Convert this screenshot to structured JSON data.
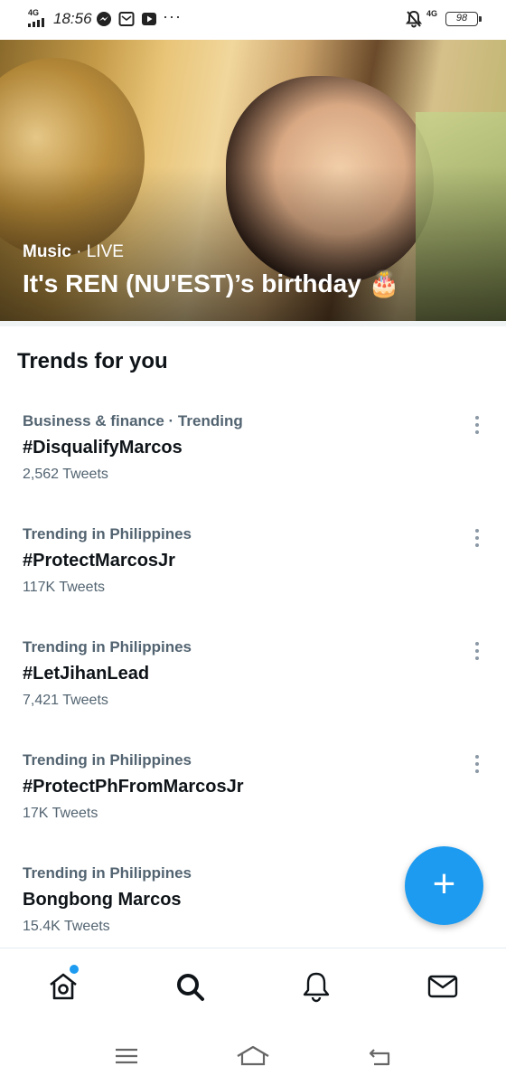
{
  "status_bar": {
    "network": "4G",
    "time": "18:56",
    "more": "···",
    "network_right": "4G",
    "battery": "98",
    "icons": [
      "signal-icon",
      "messenger-icon",
      "mail-app-icon",
      "youtube-icon",
      "bell-off-icon"
    ]
  },
  "hero": {
    "category": "Music",
    "separator": " · ",
    "status": "LIVE",
    "title": "It's REN (NU'EST)’s birthday",
    "emoji": "🎂"
  },
  "trends": {
    "heading": "Trends for you",
    "items": [
      {
        "context": "Business & finance · Trending",
        "name": "#DisqualifyMarcos",
        "count": "2,562 Tweets"
      },
      {
        "context": "Trending in Philippines",
        "name": "#ProtectMarcosJr",
        "count": "117K Tweets"
      },
      {
        "context": "Trending in Philippines",
        "name": "#LetJihanLead",
        "count": "7,421 Tweets"
      },
      {
        "context": "Trending in Philippines",
        "name": "#ProtectPhFromMarcosJr",
        "count": "17K Tweets"
      },
      {
        "context": "Trending in Philippines",
        "name": "Bongbong Marcos",
        "count": "15.4K Tweets"
      }
    ]
  },
  "fab": {
    "label": "+"
  },
  "bottom_nav": {
    "items": [
      "home-icon",
      "search-icon",
      "notifications-icon",
      "messages-icon"
    ],
    "home_has_badge": true
  },
  "colors": {
    "accent": "#1d9bf0",
    "text_primary": "#0f1419",
    "text_secondary": "#536471"
  }
}
